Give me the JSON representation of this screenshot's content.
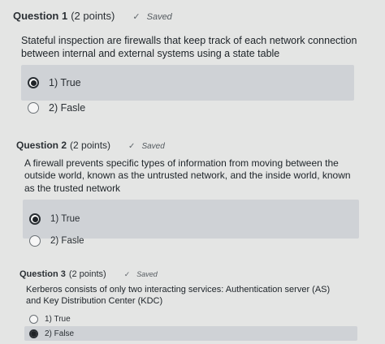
{
  "questions": [
    {
      "title": "Question 1",
      "points": "(2 points)",
      "status": "Saved",
      "text": "Stateful inspection are firewalls that keep track of each network connection between internal and external systems using a state table",
      "options": [
        {
          "label": "1)  True",
          "selected": true
        },
        {
          "label": "2)  Fasle",
          "selected": false
        }
      ]
    },
    {
      "title": "Question 2",
      "points": "(2 points)",
      "status": "Saved",
      "text": "A firewall prevents specific types of information from moving between the outside world, known as the untrusted network, and the inside world, known as the trusted network",
      "options": [
        {
          "label": "1)  True",
          "selected": true
        },
        {
          "label": "2)  Fasle",
          "selected": false
        }
      ]
    },
    {
      "title": "Question 3",
      "points": "(2 points)",
      "status": "Saved",
      "text": "Kerberos consists of only two interacting services: Authentication server (AS) and Key Distribution Center (KDC)",
      "options": [
        {
          "label": "1) True",
          "selected": false
        },
        {
          "label": "2) False",
          "selected": true
        }
      ]
    }
  ],
  "icons": {
    "saved": "check-icon",
    "option": "radio-icon"
  }
}
